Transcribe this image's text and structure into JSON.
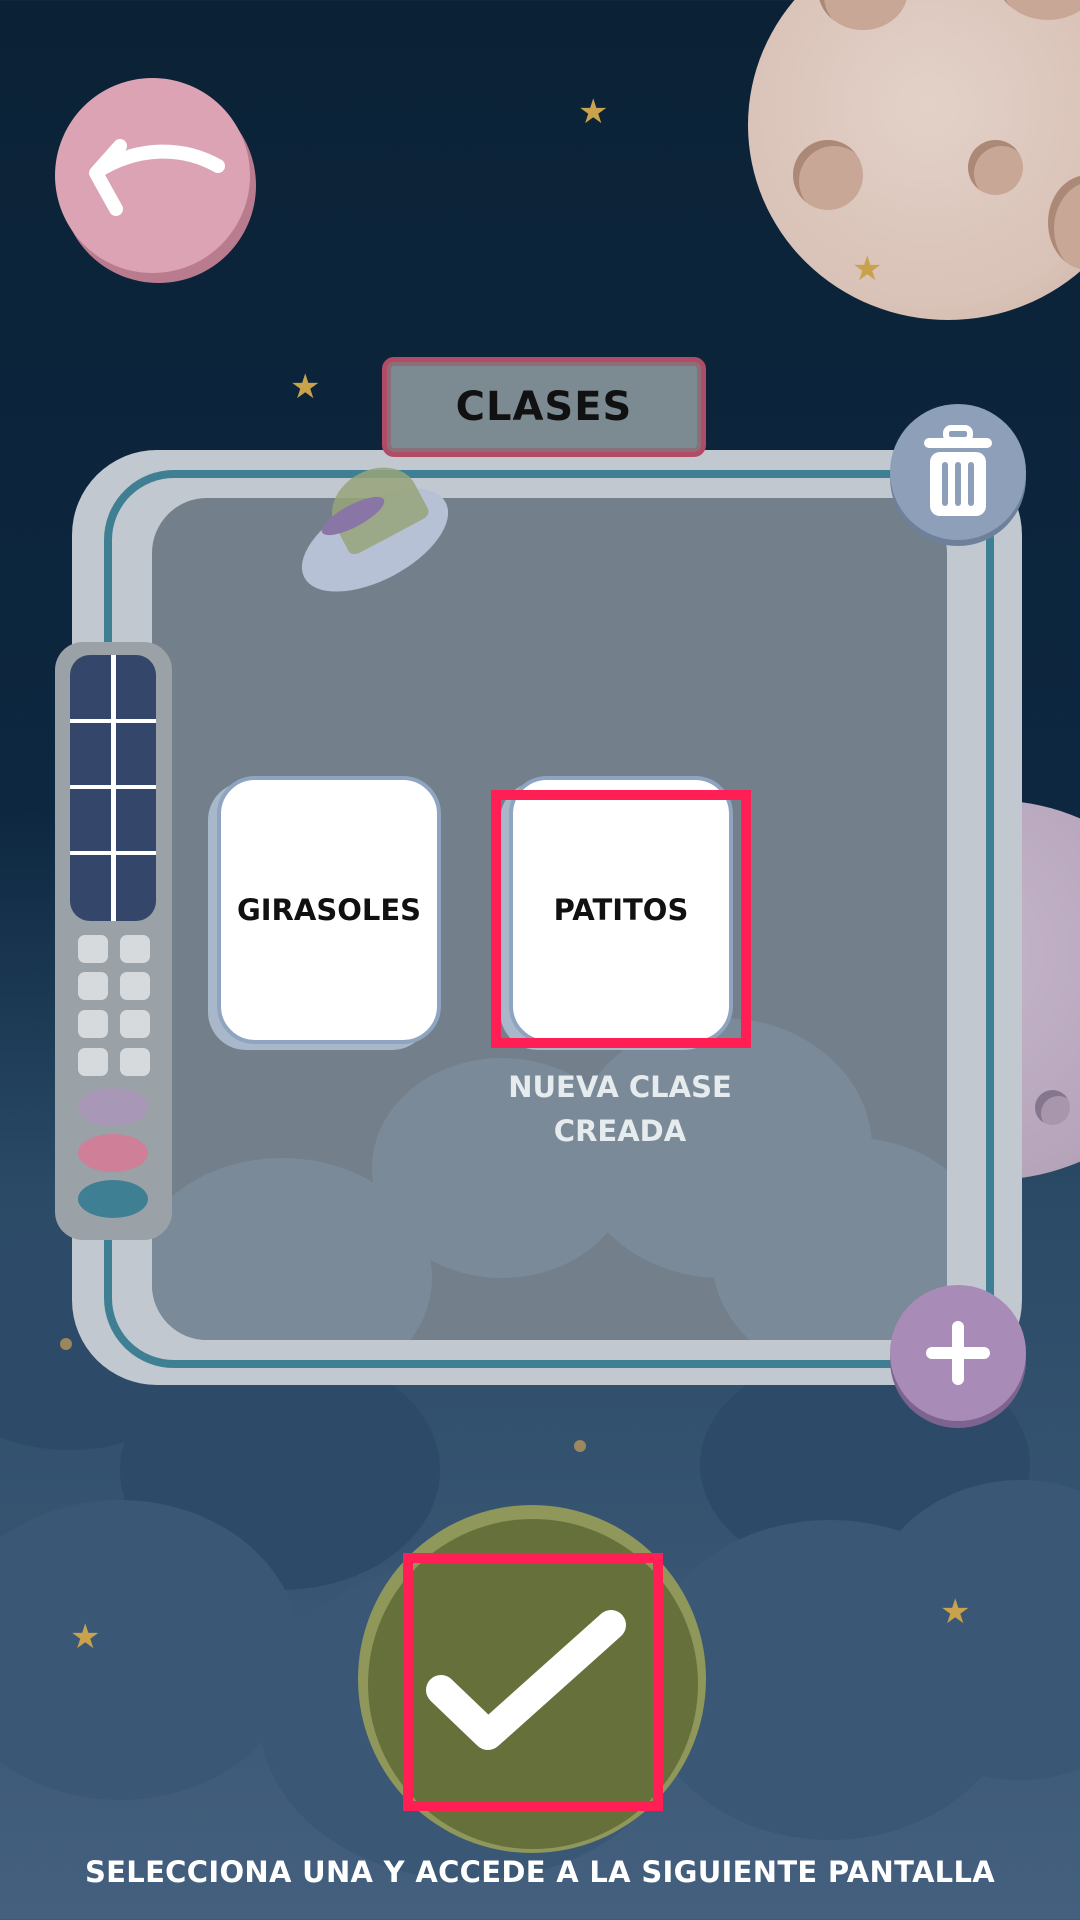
{
  "header": {
    "title": "CLASES"
  },
  "classes": [
    {
      "label": "GIRASOLES"
    },
    {
      "label": "PATITOS",
      "caption_line1": "NUEVA CLASE",
      "caption_line2": "CREADA"
    }
  ],
  "footer": {
    "instruction": "SELECCIONA UNA Y ACCEDE A LA SIGUIENTE PANTALLA"
  },
  "icons": {
    "back": "back-arrow-icon",
    "delete": "trash-icon",
    "add": "plus-icon",
    "confirm": "checkmark-icon"
  },
  "colors": {
    "highlight": "#ff1f55",
    "confirm": "#66703b",
    "back_button": "#dba3b3",
    "add_button": "#a98bb7",
    "delete_button": "#8ea0b9"
  }
}
